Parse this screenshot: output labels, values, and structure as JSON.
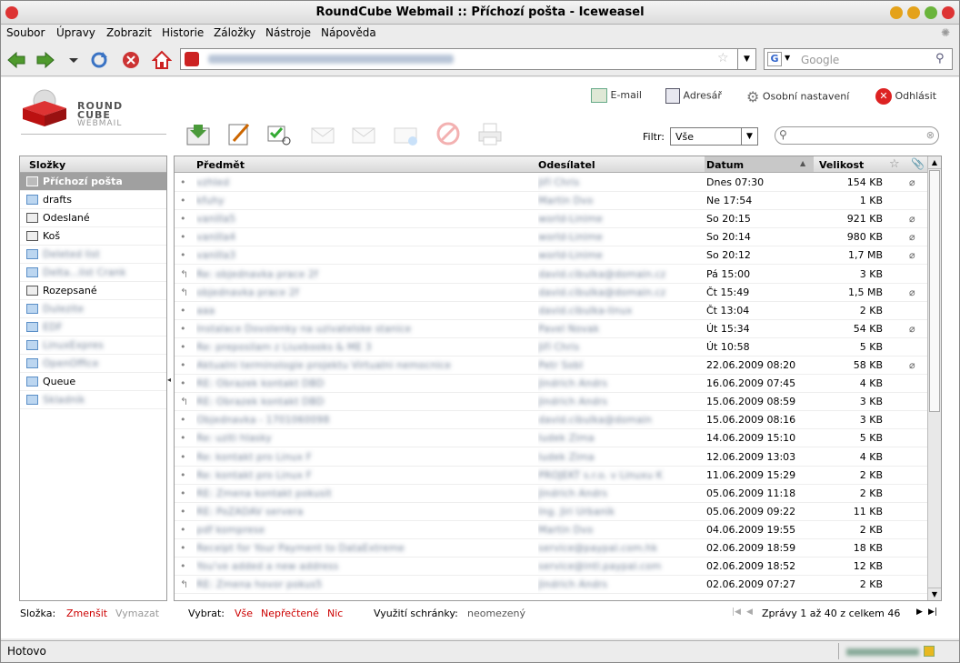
{
  "window": {
    "title": "RoundCube Webmail :: Příchozí pošta - Iceweasel"
  },
  "menu": [
    "Soubor",
    "Úpravy",
    "Zobrazit",
    "Historie",
    "Záložky",
    "Nástroje",
    "Nápověda"
  ],
  "search": {
    "placeholder": "Google"
  },
  "logo": {
    "line1": "ROUND",
    "line2": "CUBE",
    "line3": "WEBMAIL"
  },
  "toplinks": {
    "email": "E-mail",
    "addressbook": "Adresář",
    "settings": "Osobní nastavení",
    "logout": "Odhlásit"
  },
  "filter": {
    "label": "Filtr:",
    "value": "Vše"
  },
  "folders": {
    "header": "Složky",
    "items": [
      {
        "label": "Příchozí pošta",
        "selected": true,
        "blur": false
      },
      {
        "label": "drafts",
        "blur": false
      },
      {
        "label": "Odeslané",
        "blur": false
      },
      {
        "label": "Koš",
        "blur": false
      },
      {
        "label": "Deleted list",
        "blur": true
      },
      {
        "label": "Delta...list Crank",
        "blur": true
      },
      {
        "label": "Rozepsané",
        "blur": false
      },
      {
        "label": "Dulezite",
        "blur": true
      },
      {
        "label": "EDF",
        "blur": true
      },
      {
        "label": "LinuxExpres",
        "blur": true
      },
      {
        "label": "OpenOffice",
        "blur": true
      },
      {
        "label": "Queue",
        "blur": false
      },
      {
        "label": "Skladnik",
        "blur": true
      }
    ]
  },
  "columns": {
    "subject": "Předmět",
    "sender": "Odesílatel",
    "date": "Datum",
    "size": "Velikost"
  },
  "messages": [
    {
      "subject": "vzhled",
      "sender": "Jiří Chris",
      "date": "Dnes 07:30",
      "size": "154 KB",
      "att": true,
      "icon": "•"
    },
    {
      "subject": "kfuhy",
      "sender": "Martin Dvo",
      "date": "Ne 17:54",
      "size": "1 KB",
      "att": false,
      "icon": "•"
    },
    {
      "subject": "vanilla5",
      "sender": "world-Linime",
      "date": "So 20:15",
      "size": "921 KB",
      "att": true,
      "icon": "•"
    },
    {
      "subject": "vanilla4",
      "sender": "world-Linime",
      "date": "So 20:14",
      "size": "980 KB",
      "att": true,
      "icon": "•"
    },
    {
      "subject": "vanilla3",
      "sender": "world-Linime",
      "date": "So 20:12",
      "size": "1,7 MB",
      "att": true,
      "icon": "•"
    },
    {
      "subject": "Re: objednavka prace 2f",
      "sender": "david.cibulka@domain.cz",
      "date": "Pá 15:00",
      "size": "3 KB",
      "att": false,
      "icon": "↰"
    },
    {
      "subject": "objednavka prace 2f",
      "sender": "david.cibulka@domain.cz",
      "date": "Čt 15:49",
      "size": "1,5 MB",
      "att": true,
      "icon": "↰"
    },
    {
      "subject": "aaa",
      "sender": "david.cibulka-linux",
      "date": "Čt 13:04",
      "size": "2 KB",
      "att": false,
      "icon": "•"
    },
    {
      "subject": "Instalace Dovolenky na uzivatelske stanice",
      "sender": "Pavel Novak",
      "date": "Út 15:34",
      "size": "54 KB",
      "att": true,
      "icon": "•"
    },
    {
      "subject": "Re: preposilam z Liuxbooks & ME 3",
      "sender": "Jiří Chris",
      "date": "Út 10:58",
      "size": "5 KB",
      "att": false,
      "icon": "•"
    },
    {
      "subject": "Aktualni terminologie projektu Virtualni nemocnice",
      "sender": "Petr Sobl",
      "date": "22.06.2009 08:20",
      "size": "58 KB",
      "att": true,
      "icon": "•"
    },
    {
      "subject": "RE: Obrazek kontakt DBD",
      "sender": "Jindrich Andrs",
      "date": "16.06.2009 07:45",
      "size": "4 KB",
      "att": false,
      "icon": "•"
    },
    {
      "subject": "RE: Obrazek kontakt DBD",
      "sender": "Jindrich Andrs",
      "date": "15.06.2009 08:59",
      "size": "3 KB",
      "att": false,
      "icon": "↰"
    },
    {
      "subject": "Objednavka - 1701060098",
      "sender": "david.cibulka@domain",
      "date": "15.06.2009 08:16",
      "size": "3 KB",
      "att": false,
      "icon": "•"
    },
    {
      "subject": "Re: uziti hlasky",
      "sender": "ludek Zima",
      "date": "14.06.2009 15:10",
      "size": "5 KB",
      "att": false,
      "icon": "•"
    },
    {
      "subject": "Re: kontakt pro Linux F",
      "sender": "ludek Zima",
      "date": "12.06.2009 13:03",
      "size": "4 KB",
      "att": false,
      "icon": "•"
    },
    {
      "subject": "Re: kontakt pro Linux F",
      "sender": "PROJEKT s.r.o. v Linuxu K",
      "date": "11.06.2009 15:29",
      "size": "2 KB",
      "att": false,
      "icon": "•"
    },
    {
      "subject": "RE: Zmena kontakt pokusit",
      "sender": "Jindrich Andrs",
      "date": "05.06.2009 11:18",
      "size": "2 KB",
      "att": false,
      "icon": "•"
    },
    {
      "subject": "RE: PoZADAV servera",
      "sender": "Ing. Jiri Urbanik",
      "date": "05.06.2009 09:22",
      "size": "11 KB",
      "att": false,
      "icon": "•"
    },
    {
      "subject": "pdf komprese",
      "sender": "Martin Dvo",
      "date": "04.06.2009 19:55",
      "size": "2 KB",
      "att": false,
      "icon": "•"
    },
    {
      "subject": "Receipt for Your Payment to DataExtreme",
      "sender": "service@paypal.com.hk",
      "date": "02.06.2009 18:59",
      "size": "18 KB",
      "att": false,
      "icon": "•"
    },
    {
      "subject": "You've added a new address",
      "sender": "service@intl.paypal.com",
      "date": "02.06.2009 18:52",
      "size": "12 KB",
      "att": false,
      "icon": "•"
    },
    {
      "subject": "RE: Zmena hovor pokus5",
      "sender": "Jindrich Andrs",
      "date": "02.06.2009 07:27",
      "size": "2 KB",
      "att": false,
      "icon": "↰"
    }
  ],
  "footer": {
    "folder_label": "Složka:",
    "compact": "Zmenšit",
    "empty": "Vymazat",
    "select_label": "Vybrat:",
    "all": "Vše",
    "unread": "Nepřečtené",
    "none": "Nic",
    "quota_label": "Využití schránky:",
    "quota_value": "neomezený",
    "pager": "Zprávy 1 až 40 z celkem 46"
  },
  "status": {
    "text": "Hotovo"
  }
}
